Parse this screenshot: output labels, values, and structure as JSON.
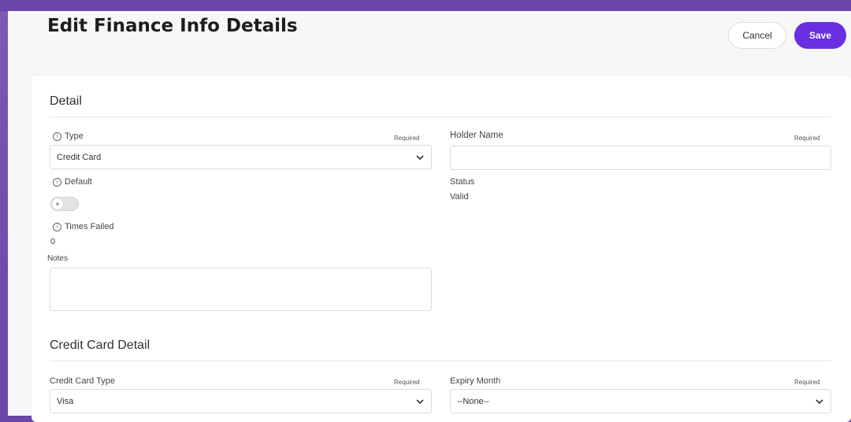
{
  "header": {
    "title": "Edit Finance Info Details",
    "cancel_label": "Cancel",
    "save_label": "Save"
  },
  "detail": {
    "section_title": "Detail",
    "required_label": "Required",
    "type": {
      "label": "Type",
      "value": "Credit Card"
    },
    "holder_name": {
      "label": "Holder Name",
      "value": ""
    },
    "default": {
      "label": "Default",
      "toggle_symbol": "×",
      "checked": false
    },
    "status": {
      "label": "Status",
      "value": "Valid"
    },
    "times_failed": {
      "label": "Times Failed",
      "value": "0"
    },
    "notes": {
      "label": "Notes",
      "value": ""
    }
  },
  "credit_card_detail": {
    "section_title": "Credit Card Detail",
    "credit_card_type": {
      "label": "Credit Card Type",
      "value": "Visa"
    },
    "expiry_month": {
      "label": "Expiry Month",
      "value": "--None--"
    }
  },
  "icons": {
    "info": "info-icon",
    "chevron": "chevron-down-icon",
    "toggle_off": "close-icon"
  },
  "colors": {
    "accent": "#6a2fe0",
    "frame": "#6a46a9"
  }
}
